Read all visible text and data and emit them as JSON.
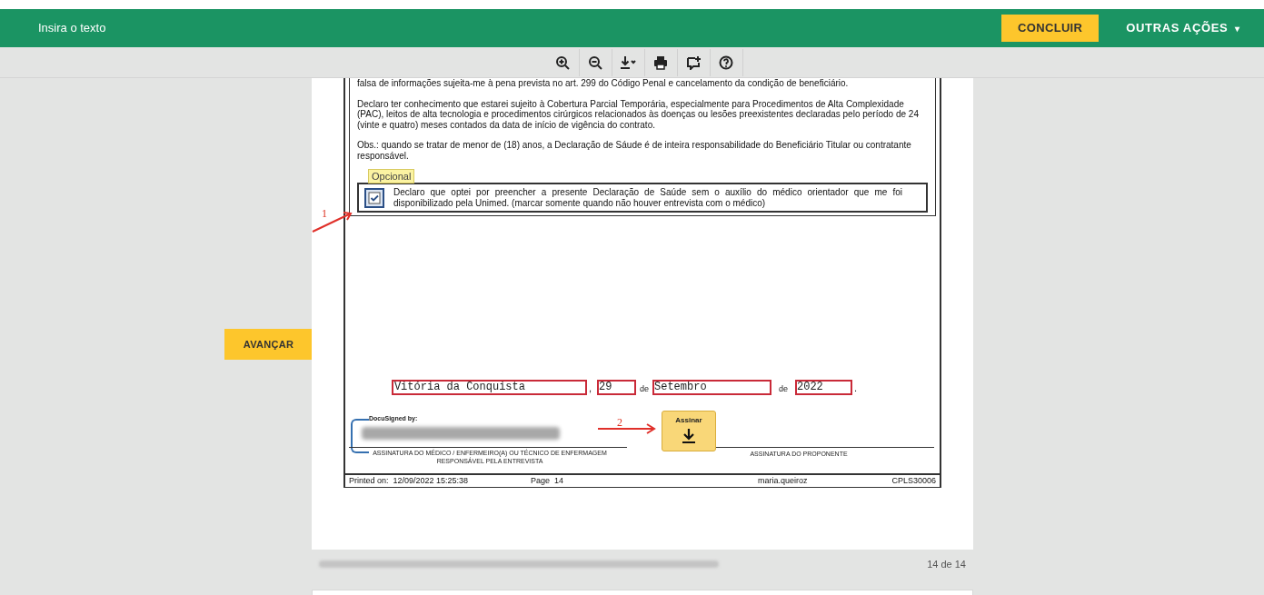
{
  "header": {
    "title": "Insira o texto",
    "finish_button": "CONCLUIR",
    "more_actions": "OUTRAS AÇÕES",
    "more_actions_caret": "▾"
  },
  "toolbar": {
    "tools": [
      {
        "kind": "zoom-in"
      },
      {
        "kind": "zoom-out"
      },
      {
        "kind": "download"
      },
      {
        "kind": "print"
      },
      {
        "kind": "comment"
      },
      {
        "kind": "help"
      }
    ]
  },
  "advance_button": "AVANÇAR",
  "document": {
    "paragraphs": [
      "falsa de informações sujeita-me à pena prevista no art. 299 do Código Penal e cancelamento da condição de beneficiário.",
      "Declaro ter conhecimento que estarei sujeito à Cobertura Parcial Temporária, especialmente para Procedimentos de Alta Complexidade (PAC), leitos de alta tecnologia e procedimentos cirúrgicos relacionados às doenças ou lesões preexistentes declaradas pelo período de 24 (vinte e quatro) meses contados da data de início de vigência do contrato.",
      "Obs.: quando se tratar de menor de (18) anos, a Declaração de Sáude é de inteira responsabilidade do Beneficiário Titular ou contratante responsável."
    ],
    "optional_tag": "Opcional",
    "optional_checkbox": {
      "checked": true,
      "label": "Declaro que optei por preencher a presente Declaração de Saúde sem o auxílio do médico orientador que me foi disponibilizado pela Unimed. (marcar somente quando não houver entrevista com o médico)"
    },
    "annotation_1": "1",
    "annotation_2": "2",
    "city": "Vitória da Conquista",
    "comma": ",",
    "day": "29",
    "de_1": "de",
    "month": "Setembro",
    "de_2": "de",
    "year": "2022",
    "period": ".",
    "docusigned_label": "DocuSigned by:",
    "sign_button": "Assinar",
    "signature_left": "ASSINATURA DO MÉDICO / ENFERMEIRO(A) OU TÉCNICO DE ENFERMAGEM RESPONSÁVEL PELA ENTREVISTA",
    "signature_right": "ASSINATURA DO PROPONENTE",
    "footer": {
      "printed_on": "Printed on:  12/09/2022 15:25:38",
      "page": "Page  14",
      "user": "maria.queiroz",
      "code": "CPLS30006"
    }
  },
  "page_counter": "14 de 14"
}
